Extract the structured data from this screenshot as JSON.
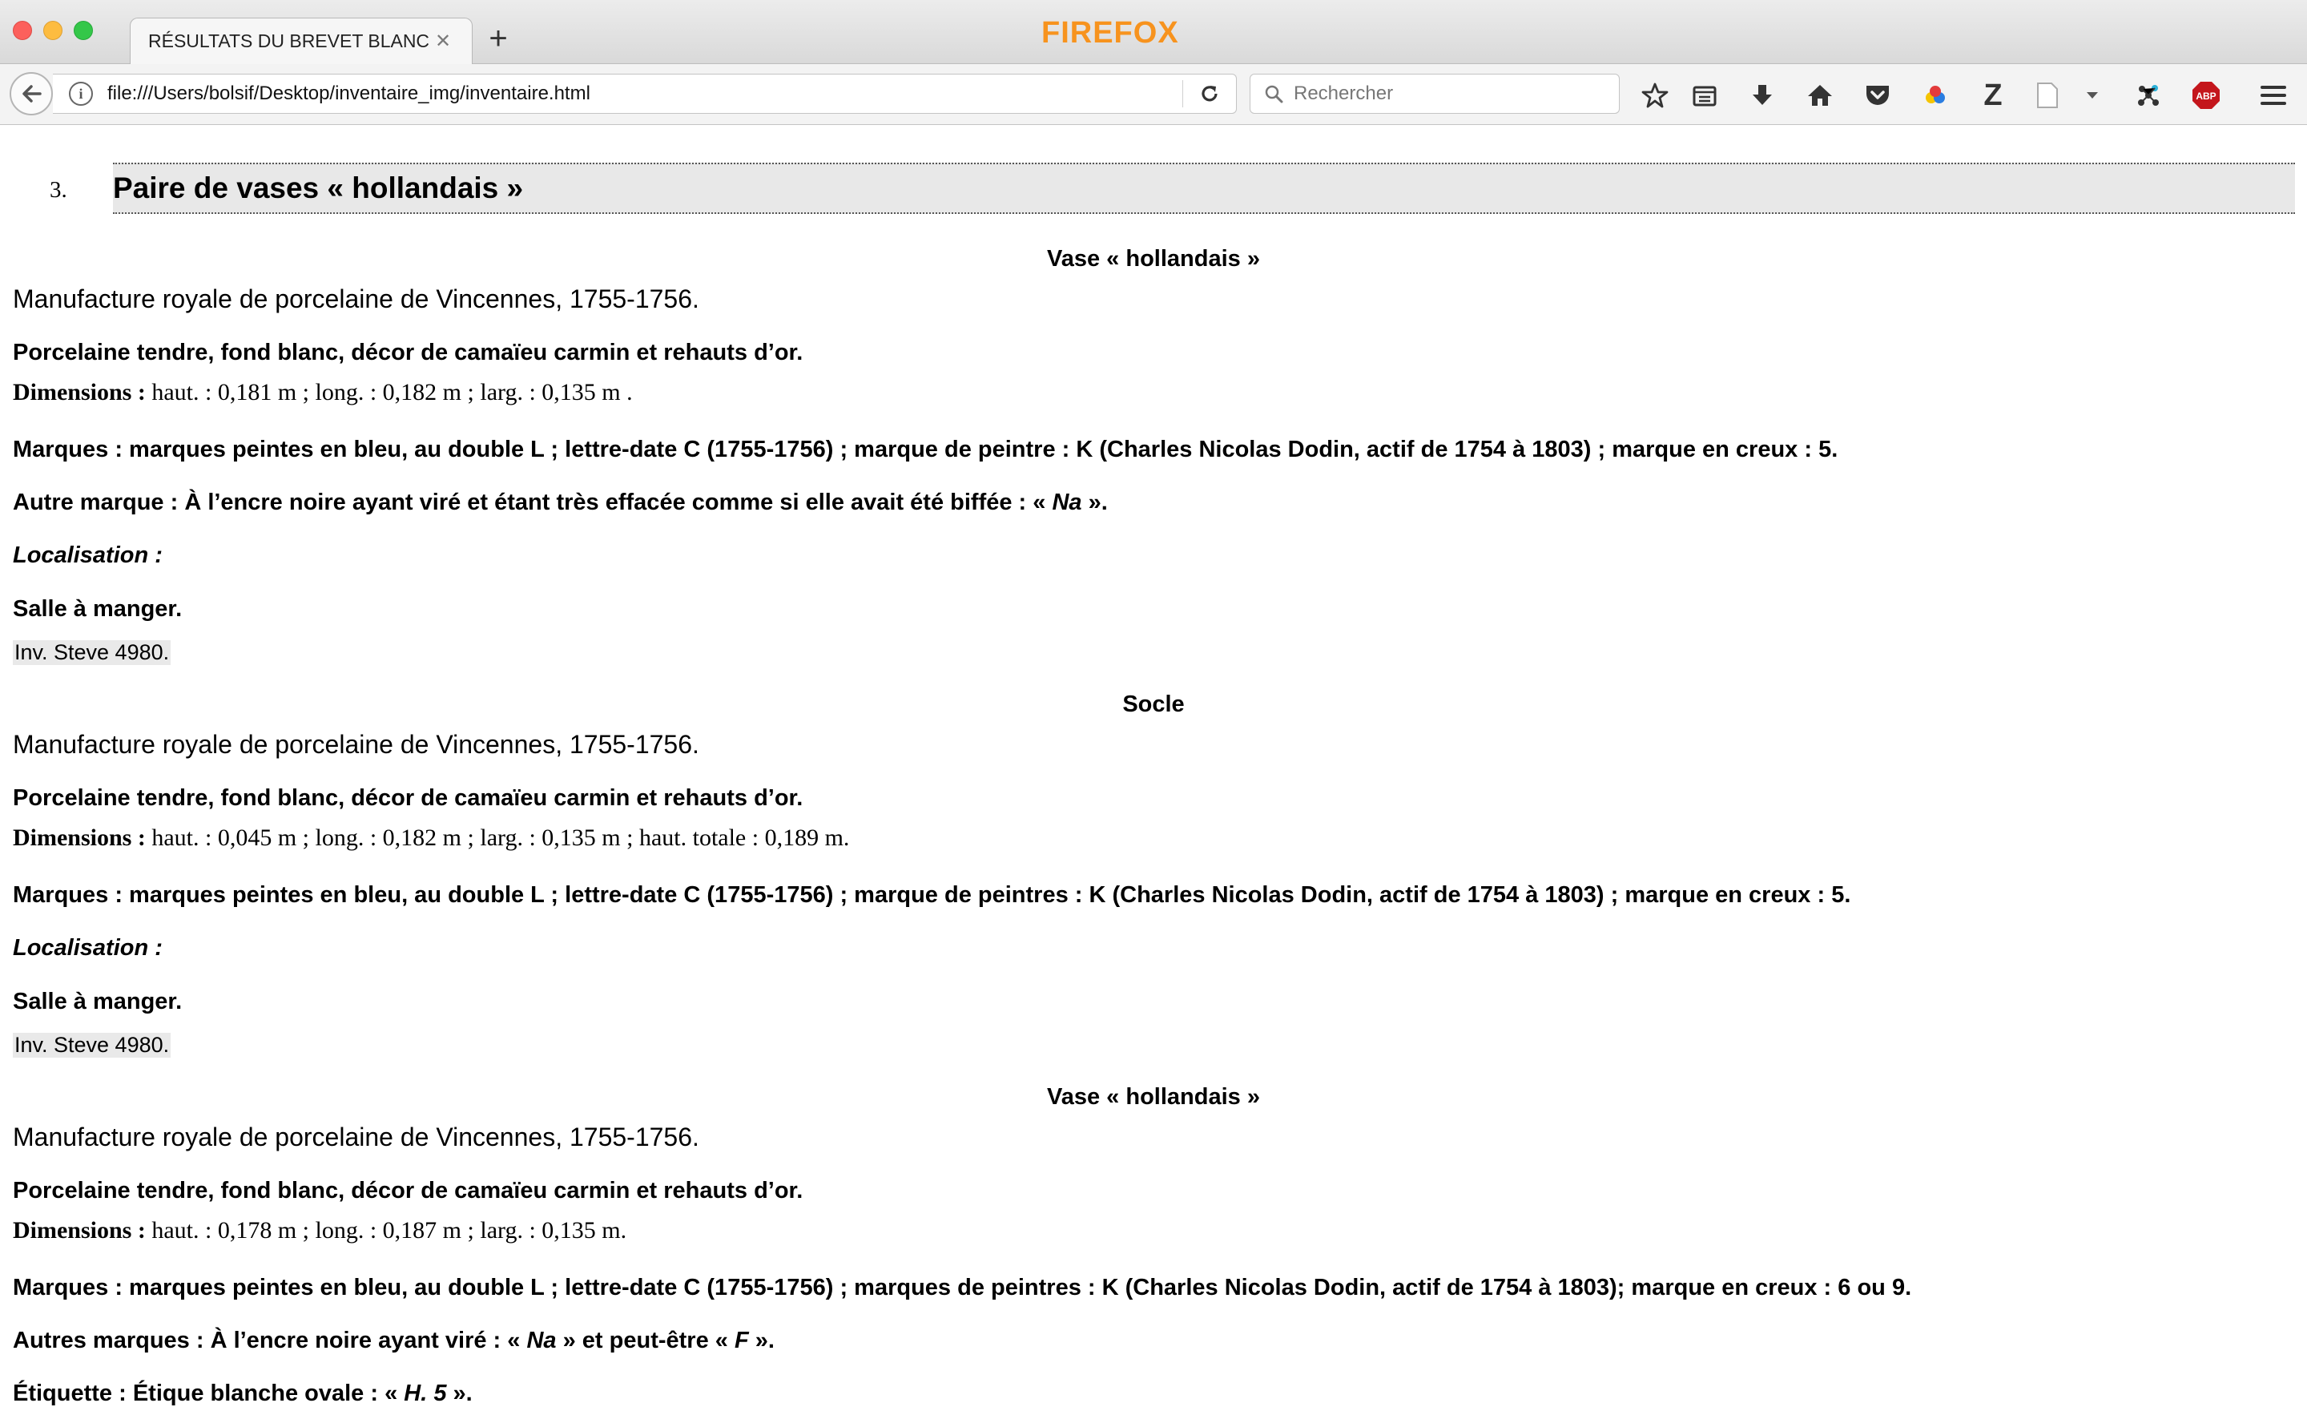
{
  "browser": {
    "brand": "FIREFOX",
    "tab": {
      "title": "RÉSULTATS DU BREVET BLANC :",
      "close": "✕"
    },
    "new_tab": "+",
    "url": "file:///Users/bolsif/Desktop/inventaire_img/inventaire.html",
    "search_placeholder": "Rechercher",
    "toolbar_icons": [
      "bookmark-star-icon",
      "reading-list-icon",
      "download-icon",
      "home-icon",
      "pocket-icon",
      "color-extension-icon",
      "zotero-icon",
      "page-icon",
      "dropdown-icon",
      "network-extension-icon",
      "adblock-icon",
      "hamburger-menu-icon"
    ],
    "adblock_label": "ABP",
    "zotero_label": "Z"
  },
  "page": {
    "section_number": "3.",
    "section_title": "Paire de vases « hollandais »",
    "blocks": [
      {
        "heading": "Vase « hollandais »",
        "manufacture": "Manufacture royale de porcelaine de Vincennes, 1755-1756.",
        "material": "Porcelaine tendre, fond blanc, décor de camaïeu carmin et rehauts d’or.",
        "dimensions_label": "Dimensions :",
        "dimensions_value": " haut. : 0,181 m ; long. : 0,182 m ; larg. : 0,135 m .",
        "marks": "Marques : marques peintes en bleu, au double L ; lettre-date C (1755-1756) ; marque de peintre : K (Charles Nicolas Dodin, actif de 1754 à 1803) ; marque en creux : 5.",
        "other_mark_pre": "Autre marque : À l’encre noire ayant viré et étant très effacée comme si elle avait été biffée : « ",
        "other_mark_it": "Na",
        "other_mark_post": " ».",
        "localisation": "Localisation :",
        "room": "Salle à manger.",
        "inventory": "Inv. Steve 4980."
      },
      {
        "heading": "Socle",
        "manufacture": "Manufacture royale de porcelaine de Vincennes, 1755-1756.",
        "material": "Porcelaine tendre, fond blanc, décor de camaïeu carmin et rehauts d’or.",
        "dimensions_label": "Dimensions :",
        "dimensions_value": " haut. : 0,045 m ; long. : 0,182 m ; larg. : 0,135 m ; haut. totale : 0,189 m.",
        "marks": "Marques : marques peintes en bleu, au double L ; lettre-date C (1755-1756) ; marque de peintres : K (Charles Nicolas Dodin, actif de 1754 à 1803) ; marque en creux : 5.",
        "localisation": "Localisation :",
        "room": "Salle à manger.",
        "inventory": "Inv. Steve 4980."
      },
      {
        "heading": "Vase « hollandais »",
        "manufacture": "Manufacture royale de porcelaine de Vincennes, 1755-1756.",
        "material": "Porcelaine tendre, fond blanc, décor de camaïeu carmin et rehauts d’or.",
        "dimensions_label": "Dimensions :",
        "dimensions_value": " haut. : 0,178 m ; long. : 0,187 m ; larg. : 0,135 m.",
        "marks": "Marques : marques peintes en bleu, au double L ; lettre-date C (1755-1756) ; marques de peintres : K (Charles Nicolas Dodin, actif de 1754 à 1803); marque en creux : 6 ou 9.",
        "other_marks_pre": "Autres marques : À l’encre noire ayant viré : « ",
        "other_marks_it1": "Na",
        "other_marks_mid": " » et peut-être « ",
        "other_marks_it2": "F",
        "other_marks_post": " ».",
        "label_pre": "Étiquette : Étique blanche ovale : « ",
        "label_it": "H. 5",
        "label_post": " »."
      }
    ]
  },
  "colors": {
    "brand": "#f7931e",
    "adblock": "#c4161c",
    "section_band": "#e8e8e8"
  }
}
